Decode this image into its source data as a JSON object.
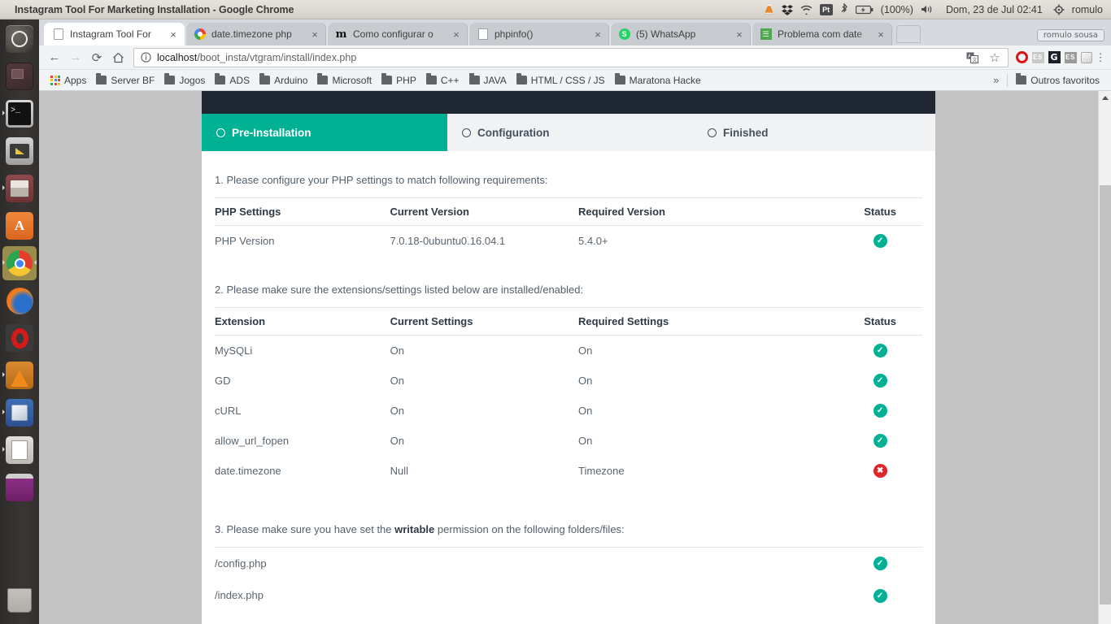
{
  "desktop": {
    "window_title": "Instagram Tool For Marketing Installation - Google Chrome",
    "tray": {
      "clock": "Dom, 23 de Jul 02:41",
      "user": "romulo",
      "battery": "(100%)",
      "items": [
        "vlc-icon",
        "dropbox-icon",
        "wifi-icon",
        "pt-keyboard-icon",
        "bluetooth-icon",
        "battery-icon",
        "volume-icon"
      ]
    },
    "launcher": [
      {
        "name": "ubuntu-dash-icon",
        "label": "Dash"
      },
      {
        "name": "workspace-switcher-icon",
        "label": "Workspace Switcher"
      },
      {
        "name": "terminal-icon",
        "label": "Terminal"
      },
      {
        "name": "display-settings-icon",
        "label": "Display"
      },
      {
        "name": "file-manager-icon",
        "label": "Files"
      },
      {
        "name": "ubuntu-software-icon",
        "label": "Ubuntu Software"
      },
      {
        "name": "google-chrome-icon",
        "label": "Google Chrome"
      },
      {
        "name": "firefox-icon",
        "label": "Firefox"
      },
      {
        "name": "opera-icon",
        "label": "Opera"
      },
      {
        "name": "vlc-icon",
        "label": "VLC Media Player"
      },
      {
        "name": "virtualbox-icon",
        "label": "VirtualBox"
      },
      {
        "name": "text-editor-icon",
        "label": "Text Editor"
      },
      {
        "name": "software-center-icon",
        "label": "Software"
      },
      {
        "name": "trash-icon",
        "label": "Trash"
      }
    ]
  },
  "browser": {
    "tabs": [
      {
        "title": "Instagram Tool For",
        "favicon": "page-icon",
        "active": true
      },
      {
        "title": "date.timezone php",
        "favicon": "google-icon",
        "active": false
      },
      {
        "title": "Como configurar o",
        "favicon": "medium-icon",
        "active": false
      },
      {
        "title": "phpinfo()",
        "favicon": "page-icon",
        "active": false
      },
      {
        "title": "(5) WhatsApp",
        "favicon": "whatsapp-icon",
        "active": false
      },
      {
        "title": "Problema com date",
        "favicon": "stackoverflow-icon",
        "active": false
      }
    ],
    "close_glyph": "×",
    "profile_chip": "romulo sousa",
    "toolbar": {
      "back": "←",
      "forward": "→",
      "reload": "⟳",
      "home": "⌂",
      "url_host": "localhost",
      "url_rest": "/boot_insta/vtgram/install/index.php",
      "info_glyph": "ⓘ",
      "translate": "translate-icon",
      "star": "☆",
      "extensions": [
        "opera-extension-icon",
        "es-extension-icon",
        "grammarly-extension-icon",
        "es2-extension-icon",
        "cube-extension-icon"
      ],
      "menu": "⋮"
    },
    "bookmarks": {
      "items": [
        {
          "label": "Apps",
          "icon": "apps-grid-icon"
        },
        {
          "label": "Server BF",
          "icon": "folder-icon"
        },
        {
          "label": "Jogos",
          "icon": "folder-icon"
        },
        {
          "label": "ADS",
          "icon": "folder-icon"
        },
        {
          "label": "Arduino",
          "icon": "folder-icon"
        },
        {
          "label": "Microsoft",
          "icon": "folder-icon"
        },
        {
          "label": "PHP",
          "icon": "folder-icon"
        },
        {
          "label": "C++",
          "icon": "folder-icon"
        },
        {
          "label": "JAVA",
          "icon": "folder-icon"
        },
        {
          "label": "HTML / CSS / JS",
          "icon": "folder-icon"
        },
        {
          "label": "Maratona Hacke",
          "icon": "folder-icon"
        }
      ],
      "overflow": "»",
      "other": {
        "label": "Outros favoritos",
        "icon": "folder-icon"
      }
    }
  },
  "installer": {
    "wizard_tabs": [
      {
        "label": "Pre-Installation",
        "active": true
      },
      {
        "label": "Configuration",
        "active": false
      },
      {
        "label": "Finished",
        "active": false
      }
    ],
    "section1": {
      "title": "1. Please configure your PHP settings to match following requirements:",
      "headers": [
        "PHP Settings",
        "Current Version",
        "Required Version",
        "Status"
      ],
      "rows": [
        {
          "name": "PHP Version",
          "current": "7.0.18-0ubuntu0.16.04.1",
          "required": "5.4.0+",
          "status": "ok"
        }
      ]
    },
    "section2": {
      "title": "2. Please make sure the extensions/settings listed below are installed/enabled:",
      "headers": [
        "Extension",
        "Current Settings",
        "Required Settings",
        "Status"
      ],
      "rows": [
        {
          "name": "MySQLi",
          "current": "On",
          "required": "On",
          "status": "ok"
        },
        {
          "name": "GD",
          "current": "On",
          "required": "On",
          "status": "ok"
        },
        {
          "name": "cURL",
          "current": "On",
          "required": "On",
          "status": "ok"
        },
        {
          "name": "allow_url_fopen",
          "current": "On",
          "required": "On",
          "status": "ok"
        },
        {
          "name": "date.timezone",
          "current": "Null",
          "required": "Timezone",
          "status": "bad"
        }
      ]
    },
    "section3": {
      "title_before": "3. Please make sure you have set the ",
      "title_bold": "writable",
      "title_after": " permission on the following folders/files:",
      "rows": [
        {
          "name": "/config.php",
          "status": "ok"
        },
        {
          "name": "/index.php",
          "status": "ok"
        }
      ]
    },
    "status_glyphs": {
      "ok": "✓",
      "bad": "✖"
    },
    "colors": {
      "accent": "#00b293",
      "header_dark": "#1f2733",
      "error": "#e0252b"
    }
  }
}
